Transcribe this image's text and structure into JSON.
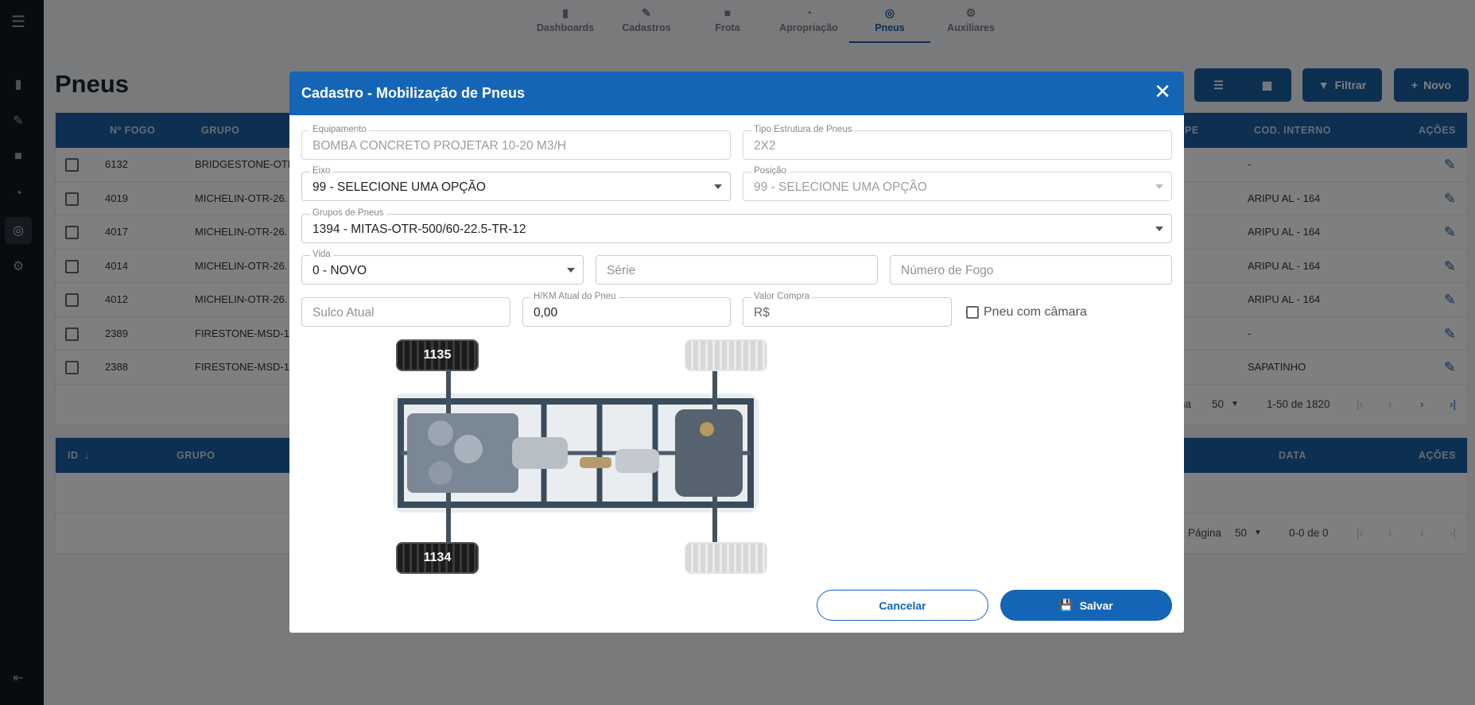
{
  "nav": [
    {
      "label": "Dashboards",
      "icon": "bar-chart-icon"
    },
    {
      "label": "Cadastros",
      "icon": "pencil-icon"
    },
    {
      "label": "Frota",
      "icon": "truck-icon"
    },
    {
      "label": "Apropriação",
      "icon": "gauge-icon"
    },
    {
      "label": "Pneus",
      "icon": "tire-icon"
    },
    {
      "label": "Auxiliares",
      "icon": "gear-icon"
    }
  ],
  "page": {
    "title": "Pneus"
  },
  "toolbar": {
    "filter_label": "Filtrar",
    "new_label": "Novo"
  },
  "table1": {
    "headers": {
      "fogo": "Nº FOGO",
      "grupo": "GRUPO",
      "pe": "PE",
      "cod": "COD. INTERNO",
      "acoes": "AÇÕES"
    },
    "rows": [
      {
        "fogo": "6132",
        "grupo": "BRIDGESTONE-OTR",
        "cod": "-"
      },
      {
        "fogo": "4019",
        "grupo": "MICHELIN-OTR-26.",
        "cod": "ARIPU AL - 164"
      },
      {
        "fogo": "4017",
        "grupo": "MICHELIN-OTR-26.",
        "cod": "ARIPU AL - 164"
      },
      {
        "fogo": "4014",
        "grupo": "MICHELIN-OTR-26.",
        "cod": "ARIPU AL - 164"
      },
      {
        "fogo": "4012",
        "grupo": "MICHELIN-OTR-26.",
        "cod": "ARIPU AL - 164"
      },
      {
        "fogo": "2389",
        "grupo": "FIRESTONE-MSD-1",
        "cod": "-"
      },
      {
        "fogo": "2388",
        "grupo": "FIRESTONE-MSD-1",
        "cod": "SAPATINHO"
      }
    ],
    "pager": {
      "label": "ina",
      "page_size": "50",
      "range": "1-50 de 1820"
    }
  },
  "table2": {
    "headers": {
      "id": "ID",
      "grupo": "GRUPO",
      "data": "DATA",
      "acoes": "AÇÕES"
    },
    "pager": {
      "label": "Página",
      "page_size": "50",
      "range": "0-0 de 0"
    }
  },
  "modal": {
    "title": "Cadastro - Mobilização de Pneus",
    "fields": {
      "equipamento": {
        "label": "Equipamento",
        "value": "BOMBA CONCRETO PROJETAR 10-20 M3/H"
      },
      "tipo_estrutura": {
        "label": "Tipo Estrutura de Pneus",
        "value": "2X2"
      },
      "eixo": {
        "label": "Eixo",
        "value": "99 - SELECIONE UMA OPÇÃO"
      },
      "posicao": {
        "label": "Posição",
        "value": "99 - SELECIONE UMA OPÇÃO"
      },
      "grupos": {
        "label": "Grupos de Pneus",
        "value": "1394 - MITAS-OTR-500/60-22.5-TR-12"
      },
      "vida": {
        "label": "Vida",
        "value": "0 - NOVO"
      },
      "serie": {
        "placeholder": "Série"
      },
      "numero_fogo": {
        "placeholder": "Número de Fogo"
      },
      "sulco": {
        "placeholder": "Sulco Atual"
      },
      "hkm": {
        "label": "H/KM Atual do Pneu",
        "value": "0,00"
      },
      "valor": {
        "label": "Valor Compra",
        "value": "R$"
      },
      "camara": {
        "label": "Pneu com câmara"
      }
    },
    "tires": {
      "front_left": "1135",
      "rear_left": "1134"
    },
    "buttons": {
      "cancel": "Cancelar",
      "save": "Salvar"
    }
  }
}
